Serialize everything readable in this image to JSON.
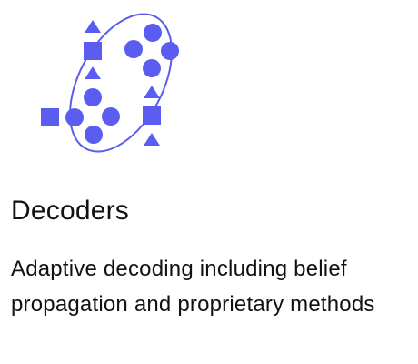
{
  "card": {
    "title": "Decoders",
    "description": "Adaptive decoding including belief propagation and proprietary methods"
  },
  "illustration": {
    "icon": "decoder-graph-icon",
    "color": "#5a5df0"
  }
}
